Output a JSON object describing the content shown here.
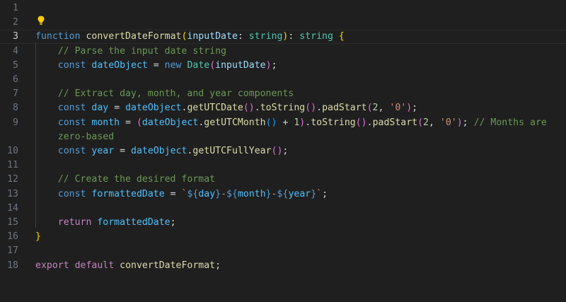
{
  "editor": {
    "language": "typescript",
    "active_line": 3,
    "lightbulb_icon": "lightbulb-icon",
    "colors": {
      "background": "#1f1f1f",
      "keyword": "#569cd6",
      "control_keyword": "#c586c0",
      "function": "#dcdcaa",
      "variable": "#9cdcfe",
      "constant": "#4fc1ff",
      "type": "#4ec9b0",
      "number": "#b5cea8",
      "string": "#ce9178",
      "comment": "#6a9955",
      "bracket_1": "#ffd700",
      "bracket_2": "#da70d6",
      "bracket_3": "#179fff"
    },
    "lines": [
      {
        "number": "1",
        "tokens": []
      },
      {
        "number": "2",
        "tokens": []
      },
      {
        "number": "3",
        "tokens": [
          {
            "t": "function",
            "c": "kw"
          },
          {
            "t": " ",
            "c": "pl"
          },
          {
            "t": "convertDateFormat",
            "c": "fn"
          },
          {
            "t": "(",
            "c": "b1"
          },
          {
            "t": "inputDate",
            "c": "var"
          },
          {
            "t": ": ",
            "c": "pl"
          },
          {
            "t": "string",
            "c": "ty"
          },
          {
            "t": ")",
            "c": "b1"
          },
          {
            "t": ": ",
            "c": "pl"
          },
          {
            "t": "string",
            "c": "ty"
          },
          {
            "t": " ",
            "c": "pl"
          },
          {
            "t": "{",
            "c": "b1"
          }
        ]
      },
      {
        "number": "4",
        "tokens": [
          {
            "t": "    ",
            "c": "pl"
          },
          {
            "t": "// Parse the input date string",
            "c": "cm"
          }
        ]
      },
      {
        "number": "5",
        "tokens": [
          {
            "t": "    ",
            "c": "pl"
          },
          {
            "t": "const",
            "c": "kw"
          },
          {
            "t": " ",
            "c": "pl"
          },
          {
            "t": "dateObject",
            "c": "cv"
          },
          {
            "t": " = ",
            "c": "pl"
          },
          {
            "t": "new",
            "c": "kw"
          },
          {
            "t": " ",
            "c": "pl"
          },
          {
            "t": "Date",
            "c": "ty"
          },
          {
            "t": "(",
            "c": "b2"
          },
          {
            "t": "inputDate",
            "c": "var"
          },
          {
            "t": ")",
            "c": "b2"
          },
          {
            "t": ";",
            "c": "pl"
          }
        ]
      },
      {
        "number": "6",
        "tokens": []
      },
      {
        "number": "7",
        "tokens": [
          {
            "t": "    ",
            "c": "pl"
          },
          {
            "t": "// Extract day, month, and year components",
            "c": "cm"
          }
        ]
      },
      {
        "number": "8",
        "tokens": [
          {
            "t": "    ",
            "c": "pl"
          },
          {
            "t": "const",
            "c": "kw"
          },
          {
            "t": " ",
            "c": "pl"
          },
          {
            "t": "day",
            "c": "cv"
          },
          {
            "t": " = ",
            "c": "pl"
          },
          {
            "t": "dateObject",
            "c": "cv"
          },
          {
            "t": ".",
            "c": "pl"
          },
          {
            "t": "getUTCDate",
            "c": "fn"
          },
          {
            "t": "()",
            "c": "b2"
          },
          {
            "t": ".",
            "c": "pl"
          },
          {
            "t": "toString",
            "c": "fn"
          },
          {
            "t": "()",
            "c": "b2"
          },
          {
            "t": ".",
            "c": "pl"
          },
          {
            "t": "padStart",
            "c": "fn"
          },
          {
            "t": "(",
            "c": "b2"
          },
          {
            "t": "2",
            "c": "num"
          },
          {
            "t": ", ",
            "c": "pl"
          },
          {
            "t": "'0'",
            "c": "str"
          },
          {
            "t": ")",
            "c": "b2"
          },
          {
            "t": ";",
            "c": "pl"
          }
        ]
      },
      {
        "number": "9",
        "tokens": [
          {
            "t": "    ",
            "c": "pl"
          },
          {
            "t": "const",
            "c": "kw"
          },
          {
            "t": " ",
            "c": "pl"
          },
          {
            "t": "month",
            "c": "cv"
          },
          {
            "t": " = ",
            "c": "pl"
          },
          {
            "t": "(",
            "c": "b2"
          },
          {
            "t": "dateObject",
            "c": "cv"
          },
          {
            "t": ".",
            "c": "pl"
          },
          {
            "t": "getUTCMonth",
            "c": "fn"
          },
          {
            "t": "()",
            "c": "b3"
          },
          {
            "t": " + ",
            "c": "pl"
          },
          {
            "t": "1",
            "c": "num"
          },
          {
            "t": ")",
            "c": "b2"
          },
          {
            "t": ".",
            "c": "pl"
          },
          {
            "t": "toString",
            "c": "fn"
          },
          {
            "t": "()",
            "c": "b2"
          },
          {
            "t": ".",
            "c": "pl"
          },
          {
            "t": "padStart",
            "c": "fn"
          },
          {
            "t": "(",
            "c": "b2"
          },
          {
            "t": "2",
            "c": "num"
          },
          {
            "t": ", ",
            "c": "pl"
          },
          {
            "t": "'0'",
            "c": "str"
          },
          {
            "t": ")",
            "c": "b2"
          },
          {
            "t": ";",
            "c": "pl"
          },
          {
            "t": " ",
            "c": "pl"
          },
          {
            "t": "// Months are",
            "c": "cm"
          }
        ]
      },
      {
        "number": "",
        "tokens": [
          {
            "t": "    ",
            "c": "pl"
          },
          {
            "t": "zero-based",
            "c": "cm"
          }
        ]
      },
      {
        "number": "10",
        "tokens": [
          {
            "t": "    ",
            "c": "pl"
          },
          {
            "t": "const",
            "c": "kw"
          },
          {
            "t": " ",
            "c": "pl"
          },
          {
            "t": "year",
            "c": "cv"
          },
          {
            "t": " = ",
            "c": "pl"
          },
          {
            "t": "dateObject",
            "c": "cv"
          },
          {
            "t": ".",
            "c": "pl"
          },
          {
            "t": "getUTCFullYear",
            "c": "fn"
          },
          {
            "t": "()",
            "c": "b2"
          },
          {
            "t": ";",
            "c": "pl"
          }
        ]
      },
      {
        "number": "11",
        "tokens": []
      },
      {
        "number": "12",
        "tokens": [
          {
            "t": "    ",
            "c": "pl"
          },
          {
            "t": "// Create the desired format",
            "c": "cm"
          }
        ]
      },
      {
        "number": "13",
        "tokens": [
          {
            "t": "    ",
            "c": "pl"
          },
          {
            "t": "const",
            "c": "kw"
          },
          {
            "t": " ",
            "c": "pl"
          },
          {
            "t": "formattedDate",
            "c": "cv"
          },
          {
            "t": " = ",
            "c": "pl"
          },
          {
            "t": "`",
            "c": "str"
          },
          {
            "t": "${",
            "c": "kw"
          },
          {
            "t": "day",
            "c": "cv"
          },
          {
            "t": "}",
            "c": "kw"
          },
          {
            "t": "-",
            "c": "str"
          },
          {
            "t": "${",
            "c": "kw"
          },
          {
            "t": "month",
            "c": "cv"
          },
          {
            "t": "}",
            "c": "kw"
          },
          {
            "t": "-",
            "c": "str"
          },
          {
            "t": "${",
            "c": "kw"
          },
          {
            "t": "year",
            "c": "cv"
          },
          {
            "t": "}",
            "c": "kw"
          },
          {
            "t": "`",
            "c": "str"
          },
          {
            "t": ";",
            "c": "pl"
          }
        ]
      },
      {
        "number": "14",
        "tokens": []
      },
      {
        "number": "15",
        "tokens": [
          {
            "t": "    ",
            "c": "pl"
          },
          {
            "t": "return",
            "c": "kw2"
          },
          {
            "t": " ",
            "c": "pl"
          },
          {
            "t": "formattedDate",
            "c": "cv"
          },
          {
            "t": ";",
            "c": "pl"
          }
        ]
      },
      {
        "number": "16",
        "tokens": [
          {
            "t": "}",
            "c": "b1"
          }
        ]
      },
      {
        "number": "17",
        "tokens": []
      },
      {
        "number": "18",
        "tokens": [
          {
            "t": "export",
            "c": "kw2"
          },
          {
            "t": " ",
            "c": "pl"
          },
          {
            "t": "default",
            "c": "kw2"
          },
          {
            "t": " ",
            "c": "pl"
          },
          {
            "t": "convertDateFormat",
            "c": "fn"
          },
          {
            "t": ";",
            "c": "pl"
          }
        ]
      }
    ]
  }
}
